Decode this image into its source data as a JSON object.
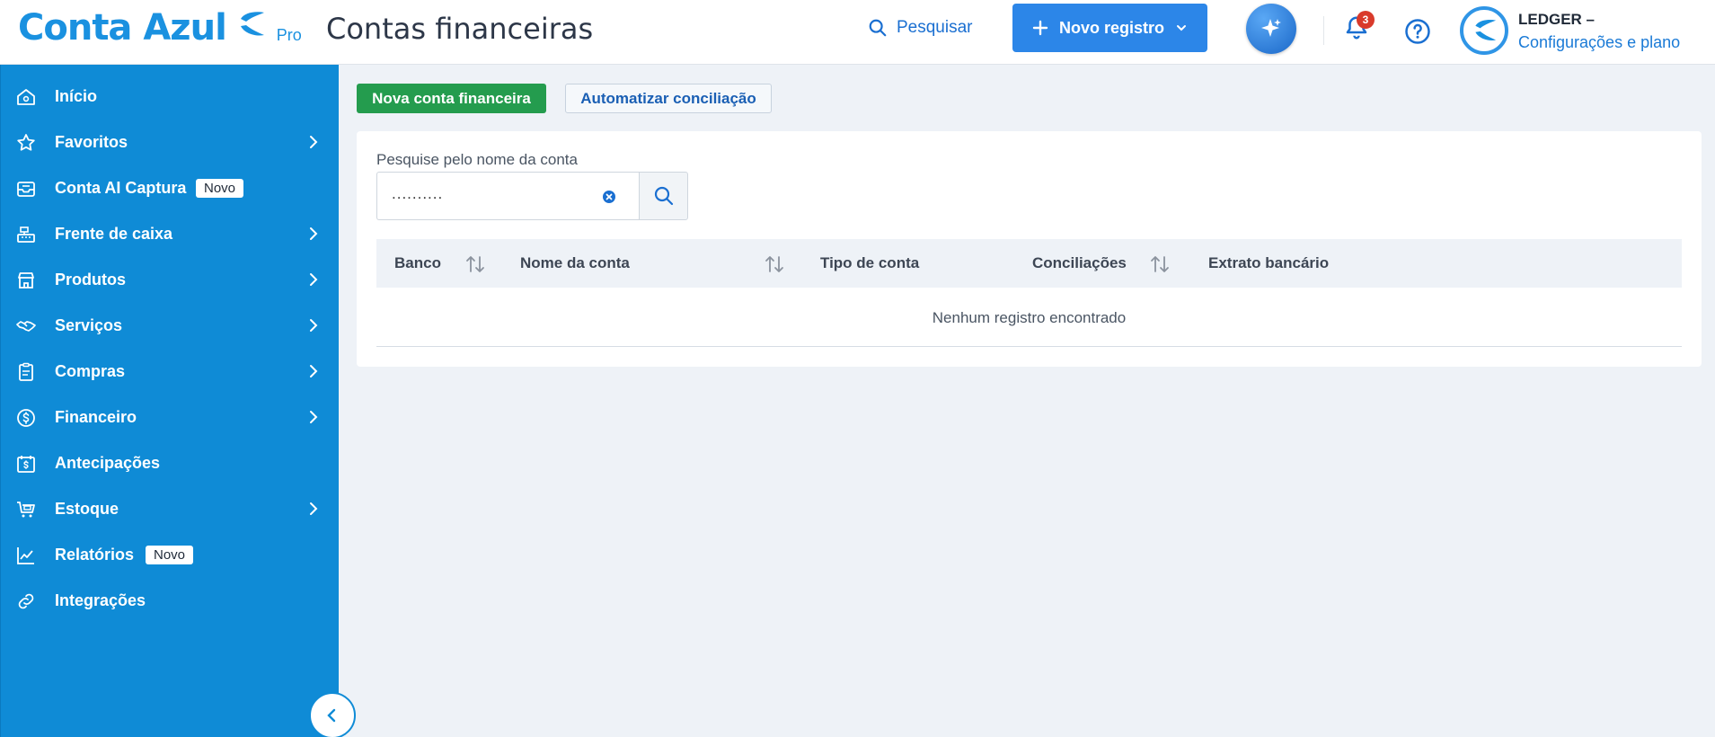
{
  "brand": {
    "name": "Conta Azul",
    "tier": "Pro",
    "color": "#1a91e0"
  },
  "header": {
    "title": "Contas financeiras",
    "search_label": "Pesquisar",
    "new_record_label": "Novo registro",
    "notification_count": "3",
    "user_name": "LEDGER –",
    "user_link": "Configurações e plano"
  },
  "sidebar": {
    "items": [
      {
        "label": "Início",
        "icon": "home-icon",
        "chevron": false
      },
      {
        "label": "Favoritos",
        "icon": "star-icon",
        "chevron": true
      },
      {
        "label": "Conta AI Captura",
        "icon": "inbox-icon",
        "chevron": false,
        "badge": "Novo"
      },
      {
        "label": "Frente de caixa",
        "icon": "cash-register-icon",
        "chevron": true
      },
      {
        "label": "Produtos",
        "icon": "store-icon",
        "chevron": true
      },
      {
        "label": "Serviços",
        "icon": "handshake-icon",
        "chevron": true
      },
      {
        "label": "Compras",
        "icon": "clipboard-icon",
        "chevron": true
      },
      {
        "label": "Financeiro",
        "icon": "dollar-circle-icon",
        "chevron": true
      },
      {
        "label": "Antecipações",
        "icon": "calendar-dollar-icon",
        "chevron": false
      },
      {
        "label": "Estoque",
        "icon": "cart-icon",
        "chevron": true
      },
      {
        "label": "Relatórios",
        "icon": "chart-line-icon",
        "chevron": false,
        "badge": "Novo"
      },
      {
        "label": "Integrações",
        "icon": "link-icon",
        "chevron": false
      }
    ]
  },
  "main": {
    "new_account_label": "Nova conta financeira",
    "automate_label": "Automatizar conciliação",
    "search": {
      "label": "Pesquise pelo nome da conta",
      "value": ".........."
    },
    "table": {
      "columns": [
        "Banco",
        "Nome da conta",
        "Tipo de conta",
        "Conciliações",
        "Extrato bancário"
      ],
      "empty_message": "Nenhum registro encontrado"
    }
  },
  "colors": {
    "sidebar": "#0f8bd6",
    "primary": "#2c86e8",
    "success": "#249c4e",
    "badge": "#d93a2b"
  }
}
